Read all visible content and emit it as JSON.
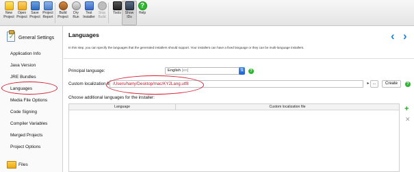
{
  "toolbar": {
    "buttons": [
      {
        "id": "new_project",
        "label": "New\nProject",
        "icon": "new-project-icon",
        "enabled": true
      },
      {
        "id": "open_project",
        "label": "Open\nProject",
        "icon": "open-project-icon",
        "enabled": true
      },
      {
        "id": "save_project",
        "label": "Save\nProject",
        "icon": "save-project-icon",
        "enabled": true
      },
      {
        "id": "project_report",
        "label": "Project\nReport",
        "icon": "project-report-icon",
        "enabled": true
      },
      {
        "id": "build_project",
        "label": "Build\nProject",
        "icon": "build-project-icon",
        "enabled": true
      },
      {
        "id": "dry_run",
        "label": "Dry\nRun",
        "icon": "dry-run-icon",
        "enabled": true
      },
      {
        "id": "test_installer",
        "label": "Test\nInstaller",
        "icon": "test-installer-icon",
        "enabled": true
      },
      {
        "id": "stop_build",
        "label": "Stop\nBuild",
        "icon": "stop-build-icon",
        "enabled": false
      },
      {
        "id": "tools",
        "label": "Tools",
        "icon": "tools-icon",
        "enabled": true
      },
      {
        "id": "show_ids",
        "label": "Show\nIDs",
        "icon": "show-ids-icon",
        "enabled": true
      },
      {
        "id": "help",
        "label": "Help",
        "icon": "help-icon",
        "enabled": true
      }
    ]
  },
  "sidebar": {
    "section_title": "General Settings",
    "items": [
      {
        "label": "Application Info",
        "selected": false
      },
      {
        "label": "Java Version",
        "selected": false
      },
      {
        "label": "JRE Bundles",
        "selected": false
      },
      {
        "label": "Languages",
        "selected": true
      },
      {
        "label": "Media File Options",
        "selected": false
      },
      {
        "label": "Code Signing",
        "selected": false
      },
      {
        "label": "Compiler Variables",
        "selected": false
      },
      {
        "label": "Merged Projects",
        "selected": false
      },
      {
        "label": "Project Options",
        "selected": false
      }
    ],
    "next_section": "Files"
  },
  "main": {
    "title": "Languages",
    "description": "In this step, you can specify the languages that the generated installers should support. Your installers can have a fixed language or they can be multi-language installers.",
    "principal_language_label": "Principal language:",
    "principal_language_value": "English",
    "principal_language_code": "[en]",
    "custom_localization_label": "Custom localization file:",
    "custom_localization_value": "/Users/harry/Desktop/mac/KY2Lang.utf8",
    "create_label": "Create",
    "browse_label": "...",
    "additional_languages_label": "Choose additional languages for the installer:",
    "table_headers": [
      "Language",
      "Custom localization file"
    ],
    "table_rows": []
  },
  "colors": {
    "accent": "#1a84e0",
    "annotation": "#d6182a",
    "help_green": "#2fb42f",
    "path_text": "#c0182a"
  }
}
